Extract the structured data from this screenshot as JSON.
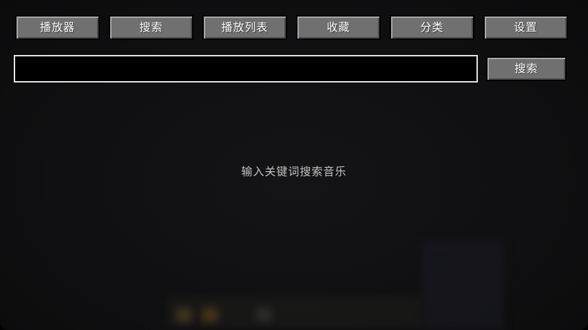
{
  "tabs": [
    {
      "label": "播放器"
    },
    {
      "label": "搜索"
    },
    {
      "label": "播放列表"
    },
    {
      "label": "收藏"
    },
    {
      "label": "分类"
    },
    {
      "label": "设置"
    }
  ],
  "search": {
    "value": "",
    "placeholder": "",
    "button_label": "搜索"
  },
  "main": {
    "hint": "输入关键词搜索音乐"
  },
  "colors": {
    "button_face": "#707070",
    "input_border": "#e8e8e8",
    "background": "#121214"
  }
}
